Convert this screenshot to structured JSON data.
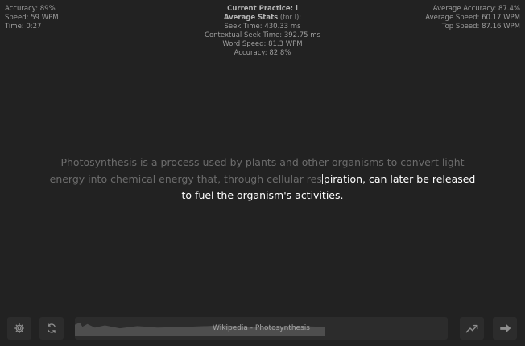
{
  "session_stats": {
    "accuracy": "Accuracy: 89%",
    "speed": "Speed: 59 WPM",
    "time": "Time: 0:27"
  },
  "practice": {
    "current_label": "Current Practice: l",
    "average_title": "Average Stats",
    "average_qualifier": " (for l):",
    "seek_time": "Seek Time: 430.33 ms",
    "contextual_seek_time": "Contextual Seek Time: 392.75 ms",
    "word_speed": "Word Speed: 81.3 WPM",
    "accuracy": "Accuracy: 82.8%"
  },
  "overall_stats": {
    "average_accuracy": "Average Accuracy: 87.4%",
    "average_speed": "Average Speed: 60.17 WPM",
    "top_speed": "Top Speed: 87.16 WPM"
  },
  "passage": {
    "typed": "Photosynthesis is a process used by plants and other organisms to convert light energy into chemical energy that, through cellular res",
    "pending": "piration, can later be released to fuel the organism's activities."
  },
  "source": {
    "label": "Wikipedia - Photosynthesis",
    "progress": 0.67
  },
  "icons": {
    "settings": "gear-icon",
    "restart": "refresh-icon",
    "stats": "chart-line-icon",
    "next": "arrow-right-icon"
  }
}
